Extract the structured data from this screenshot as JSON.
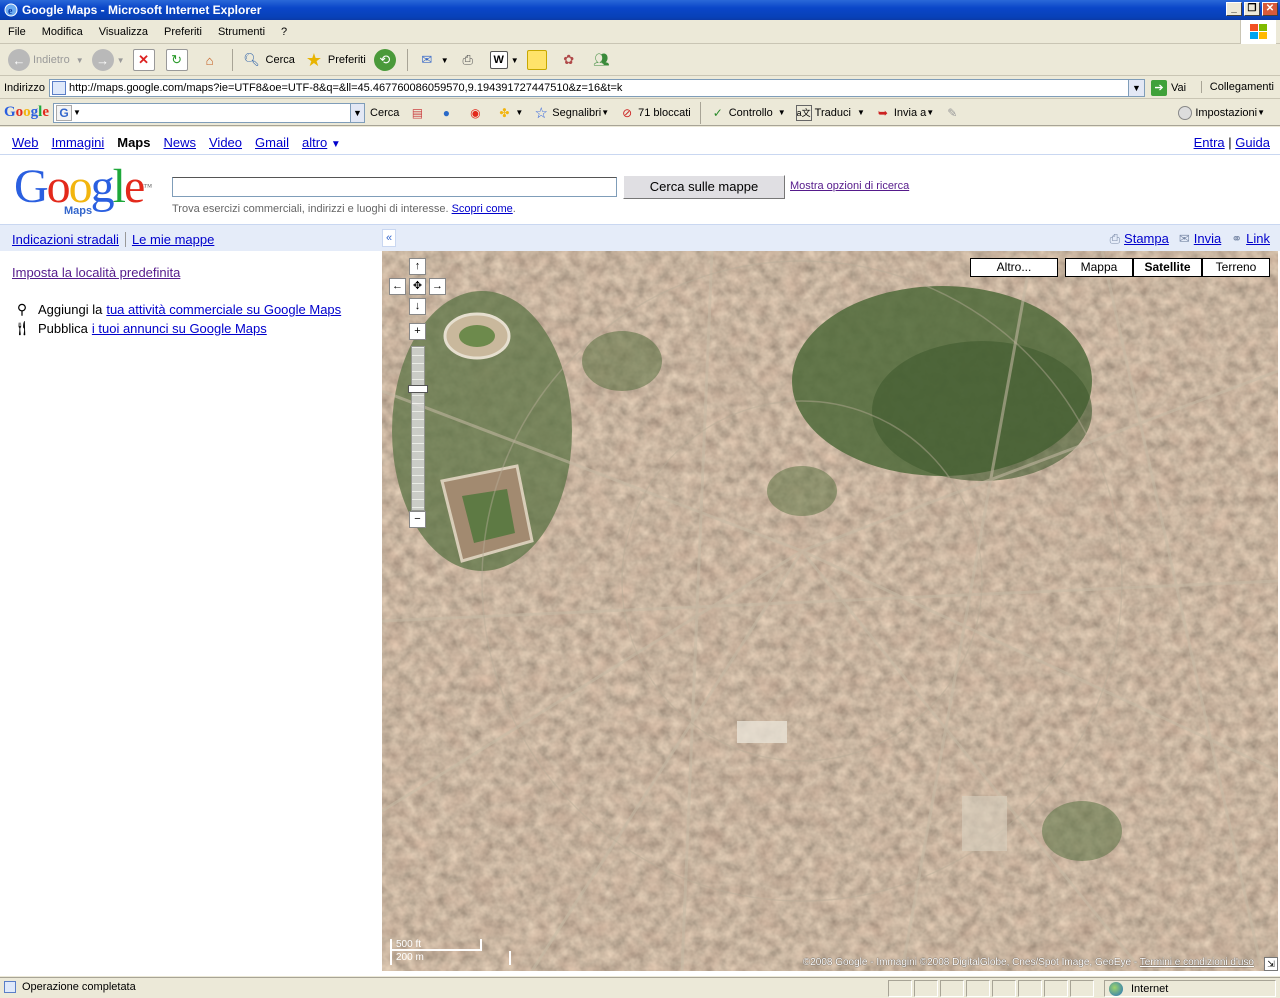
{
  "window": {
    "title": "Google Maps - Microsoft Internet Explorer",
    "buttons": [
      "_",
      "❐",
      "✕"
    ]
  },
  "menu": [
    "File",
    "Modifica",
    "Visualizza",
    "Preferiti",
    "Strumenti",
    "?"
  ],
  "toolbar": {
    "back": "Indietro",
    "search": "Cerca",
    "favorites": "Preferiti"
  },
  "address": {
    "label": "Indirizzo",
    "url": "http://maps.google.com/maps?ie=UTF8&oe=UTF-8&q=&ll=45.467760086059570,9.194391727447510&z=16&t=k",
    "go": "Vai",
    "links": "Collegamenti"
  },
  "google_toolbar": {
    "logo": "Google",
    "search": "Cerca",
    "bookmarks": "Segnalibri",
    "blocked": "71 bloccati",
    "check": "Controllo",
    "translate": "Traduci",
    "send": "Invia a",
    "settings": "Impostazioni"
  },
  "gbar": {
    "links": [
      "Web",
      "Immagini",
      "Maps",
      "News",
      "Video",
      "Gmail",
      "altro"
    ],
    "selected": "Maps",
    "more_arrow": "▼",
    "signin": "Entra",
    "help": "Guida"
  },
  "header": {
    "logo_letters": [
      "G",
      "o",
      "o",
      "g",
      "l",
      "e"
    ],
    "logo_sub": "Maps",
    "search_button": "Cerca sulle mappe",
    "search_options": "Mostra opzioni di ricerca",
    "hint": "Trova esercizi commerciali, indirizzi e luoghi di interesse.",
    "hint_link": "Scopri come"
  },
  "subbar": {
    "directions": "Indicazioni stradali",
    "my_maps": "Le mie mappe",
    "collapse": "«",
    "print": "Stampa",
    "send": "Invia",
    "link": "Link"
  },
  "sidebar": {
    "set_location": "Imposta la località predefinita",
    "add_business_prefix": "Aggiungi la",
    "add_business_link": "tua attività commerciale su Google Maps",
    "publish_prefix": "Pubblica",
    "publish_link": "i tuoi annunci su Google Maps"
  },
  "map": {
    "types": [
      "Altro...",
      "Mappa",
      "Satellite",
      "Terreno"
    ],
    "active_type": "Satellite",
    "scale_ft": "500 ft",
    "scale_m": "200 m",
    "copyright": "©2008 Google - Immagini ©2008 DigitalGlobe, Cnes/Spot Image, GeoEye -",
    "terms": "Termini e condizioni d'uso",
    "zoom_in": "+",
    "zoom_out": "−"
  },
  "status": {
    "message": "Operazione completata",
    "zone": "Internet"
  },
  "colors": {
    "title_bar": "#0a46c8",
    "link": "#0000cc",
    "visited": "#551a8b",
    "subbar_bg": "#e5ecf9"
  }
}
